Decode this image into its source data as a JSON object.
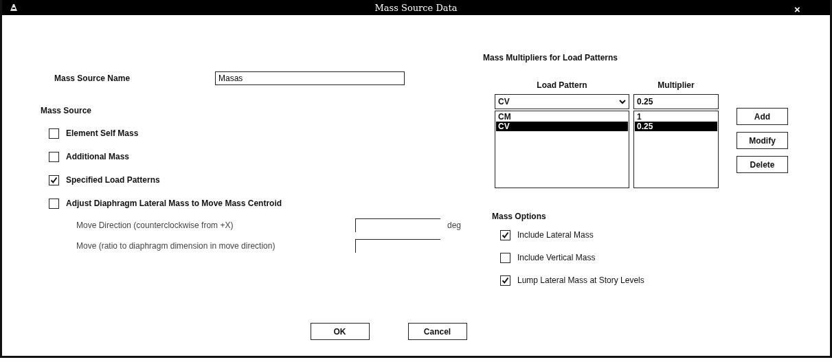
{
  "window": {
    "title": "Mass Source Data",
    "close": "×"
  },
  "mass_source_name": {
    "label": "Mass Source Name",
    "value": "Masas"
  },
  "mass_source": {
    "heading": "Mass Source",
    "options": [
      {
        "label": "Element Self Mass",
        "checked": false
      },
      {
        "label": "Additional Mass",
        "checked": false
      },
      {
        "label": "Specified Load Patterns",
        "checked": true
      },
      {
        "label": "Adjust Diaphragm Lateral Mass to Move Mass Centroid",
        "checked": false
      }
    ],
    "fields": [
      {
        "label": "Move Direction (counterclockwise from +X)",
        "unit": "deg"
      },
      {
        "label": "Move (ratio to diaphragm dimension in move direction)"
      }
    ]
  },
  "multipliers": {
    "heading": "Mass Multipliers for Load Patterns",
    "columns": [
      "Load Pattern",
      "Multiplier"
    ],
    "load_pattern": "CV",
    "multiplier": "0.25",
    "rows": [
      {
        "load_pattern": "CM",
        "multiplier": "1",
        "selected": false
      },
      {
        "load_pattern": "CV",
        "multiplier": "0.25",
        "selected": true
      }
    ],
    "buttons": [
      "Add",
      "Modify",
      "Delete"
    ]
  },
  "mass_options": {
    "heading": "Mass Options",
    "options": [
      {
        "label": "Include Lateral Mass",
        "checked": true
      },
      {
        "label": "Include Vertical Mass",
        "checked": false
      },
      {
        "label": "Lump Lateral Mass at Story Levels",
        "checked": true
      }
    ]
  },
  "buttons": [
    "OK",
    "Cancel"
  ]
}
